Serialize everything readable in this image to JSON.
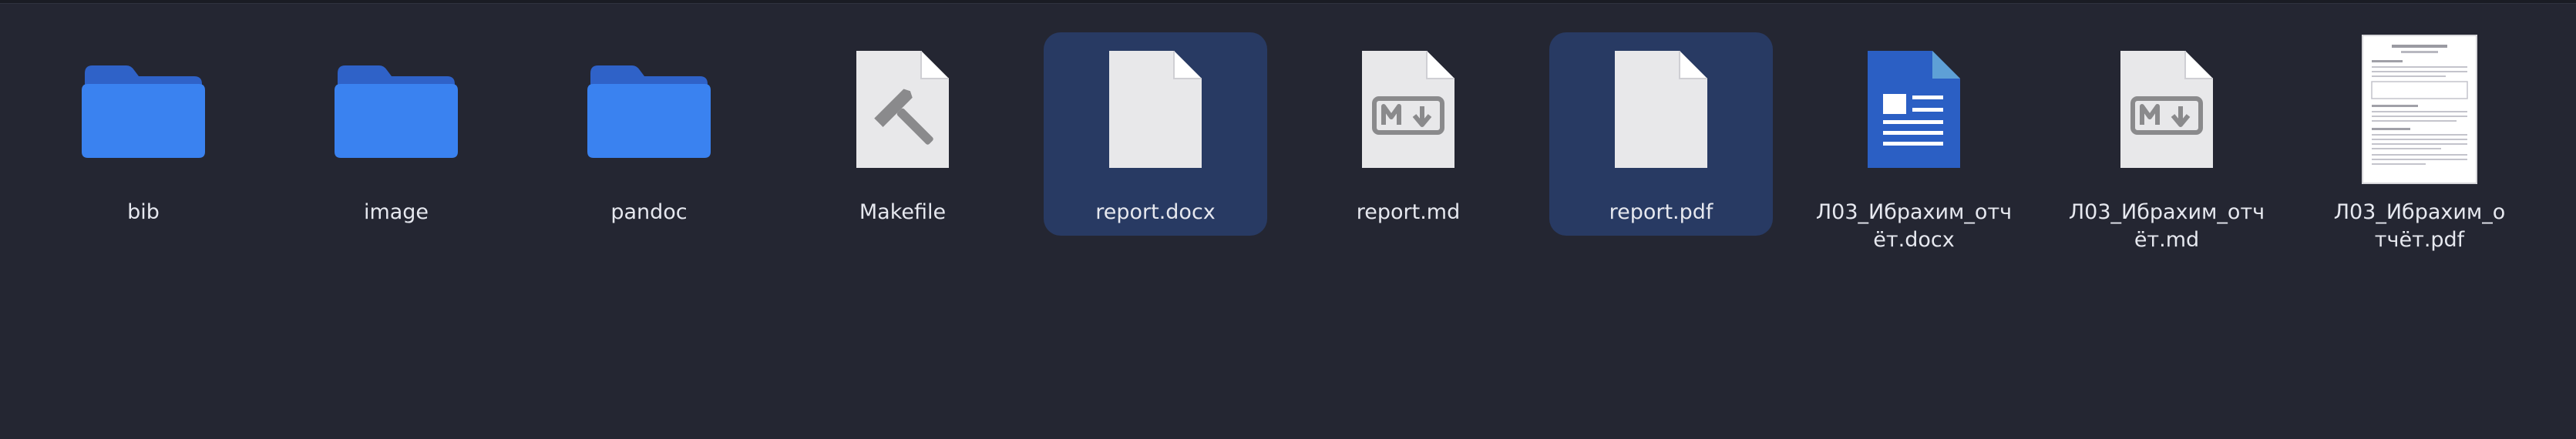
{
  "window": {
    "background": "#242632",
    "selection_color": "#283a63"
  },
  "files": [
    {
      "name": "bib",
      "icon": "folder-icon",
      "selected": false
    },
    {
      "name": "image",
      "icon": "folder-icon",
      "selected": false
    },
    {
      "name": "pandoc",
      "icon": "folder-icon",
      "selected": false
    },
    {
      "name": "Makefile",
      "icon": "makefile-icon",
      "selected": false
    },
    {
      "name": "report.docx",
      "icon": "blank-document-icon",
      "selected": true
    },
    {
      "name": "report.md",
      "icon": "markdown-icon",
      "selected": false
    },
    {
      "name": "report.pdf",
      "icon": "blank-document-icon",
      "selected": true
    },
    {
      "name": "Л03_Ибрахим_отч\nёт.docx",
      "icon": "word-document-icon",
      "selected": false
    },
    {
      "name": "Л03_Ибрахим_отч\nёт.md",
      "icon": "markdown-icon",
      "selected": false
    },
    {
      "name": "Л03_Ибрахим_о\nтчёт.pdf",
      "icon": "pdf-thumbnail-icon",
      "selected": false
    }
  ]
}
